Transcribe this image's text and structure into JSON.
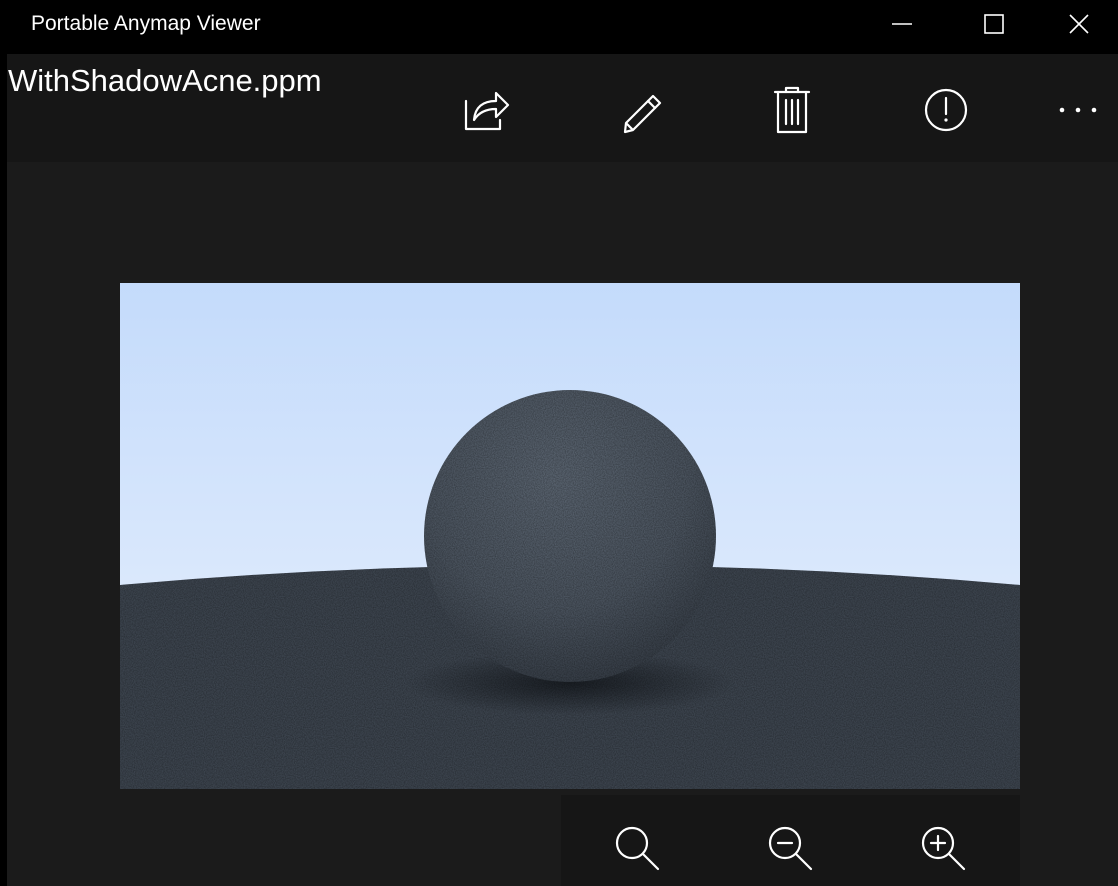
{
  "window": {
    "title": "Portable Anymap Viewer",
    "controls": [
      "minimize-icon",
      "maximize-icon",
      "close-icon"
    ]
  },
  "header": {
    "file_name": "WithShadowAcne.ppm"
  },
  "commandbar": {
    "items": [
      "share-icon",
      "edit-pencil-icon",
      "delete-trash-icon",
      "info-icon",
      "more-options-icon"
    ]
  },
  "zoombar": {
    "items": [
      "zoom-reset-icon",
      "zoom-out-icon",
      "zoom-in-icon"
    ]
  },
  "colors": {
    "titlebar": "#000000",
    "window_body": "#1b1b1b",
    "commandbar": "#161616",
    "icon": "#ffffff",
    "sky_top": "#c3dafb",
    "sky_bottom": "#e8f1fd",
    "ground": "#3b434d",
    "sphere": "#4a5563"
  }
}
